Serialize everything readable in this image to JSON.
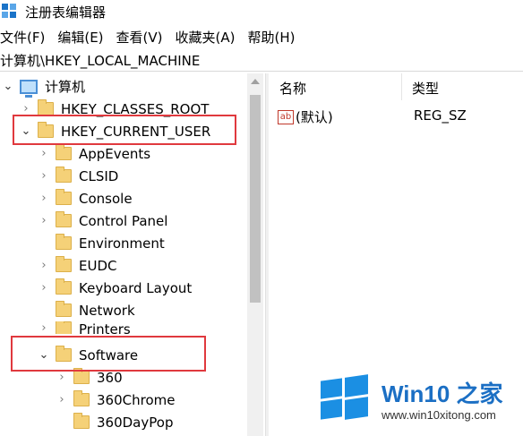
{
  "window": {
    "title": "注册表编辑器"
  },
  "menu": [
    "文件(F)",
    "编辑(E)",
    "查看(V)",
    "收藏夹(A)",
    "帮助(H)"
  ],
  "address": "计算机\\HKEY_LOCAL_MACHINE",
  "tree": {
    "root": "计算机",
    "hkcr": "HKEY_CLASSES_ROOT",
    "hkcu": "HKEY_CURRENT_USER",
    "children": [
      "AppEvents",
      "CLSID",
      "Console",
      "Control Panel",
      "Environment",
      "EUDC",
      "Keyboard Layout",
      "Network",
      "Printers",
      "Software"
    ],
    "software_children": [
      "360",
      "360Chrome",
      "360DayPop"
    ]
  },
  "values_pane": {
    "col_name": "名称",
    "col_type": "类型",
    "row": {
      "name": "(默认)",
      "type": "REG_SZ",
      "icon_text": "ab"
    }
  },
  "watermark": {
    "brand": "Win10 之家",
    "url": "www.win10xitong.com"
  },
  "colors": {
    "highlight_box": "#e0393e",
    "folder": "#f5d178",
    "accent": "#1b8fe3"
  },
  "icons": {
    "computer": "computer-icon",
    "folder": "folder-icon",
    "string_value": "string-value-icon"
  }
}
